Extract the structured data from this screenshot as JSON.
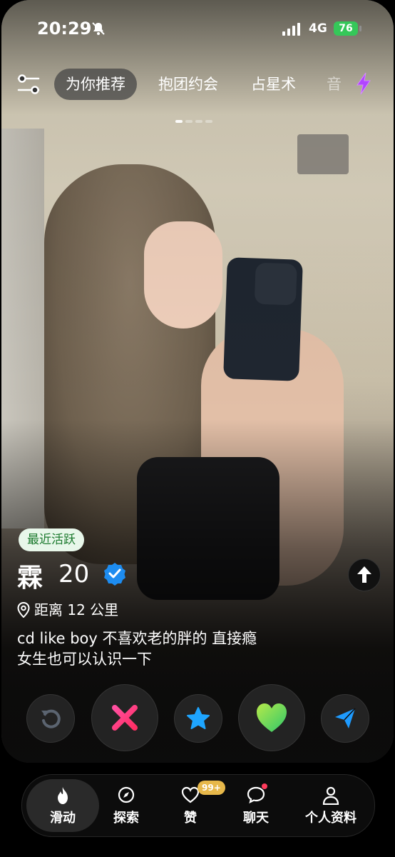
{
  "status_bar": {
    "time": "20:29",
    "network": "4G",
    "battery": "76"
  },
  "top_nav": {
    "tabs": [
      {
        "label": "为你推荐",
        "active": true
      },
      {
        "label": "抱团约会"
      },
      {
        "label": "占星术"
      },
      {
        "label": "音"
      }
    ],
    "photo_count": 4,
    "current_photo": 1
  },
  "profile": {
    "activity_badge": "最近活跃",
    "name": "霖",
    "age": "20",
    "verified": true,
    "distance": "距离 12 公里",
    "bio_line1": "cd like boy 不喜欢老的胖的 直接瘾",
    "bio_line2": "女生也可以认识一下"
  },
  "actions": [
    {
      "name": "rewind",
      "icon": "rewind-icon"
    },
    {
      "name": "nope",
      "icon": "x-icon",
      "color": "#ff3f7b"
    },
    {
      "name": "super-like",
      "icon": "star-icon",
      "color": "#1ea5ff"
    },
    {
      "name": "like",
      "icon": "heart-icon",
      "color": "#7fe04b"
    },
    {
      "name": "boost",
      "icon": "send-icon",
      "color": "#1e9bff"
    }
  ],
  "bottom_nav": {
    "items": [
      {
        "label": "滑动",
        "icon": "flame-icon",
        "active": true
      },
      {
        "label": "探索",
        "icon": "compass-icon"
      },
      {
        "label": "赞",
        "icon": "heart-outline-icon",
        "badge": "99+"
      },
      {
        "label": "聊天",
        "icon": "chat-icon"
      },
      {
        "label": "个人资料",
        "icon": "person-icon"
      }
    ]
  },
  "colors": {
    "verified": "#1d8cf0",
    "likes_badge": "#e7b84a",
    "battery": "#35c759"
  }
}
